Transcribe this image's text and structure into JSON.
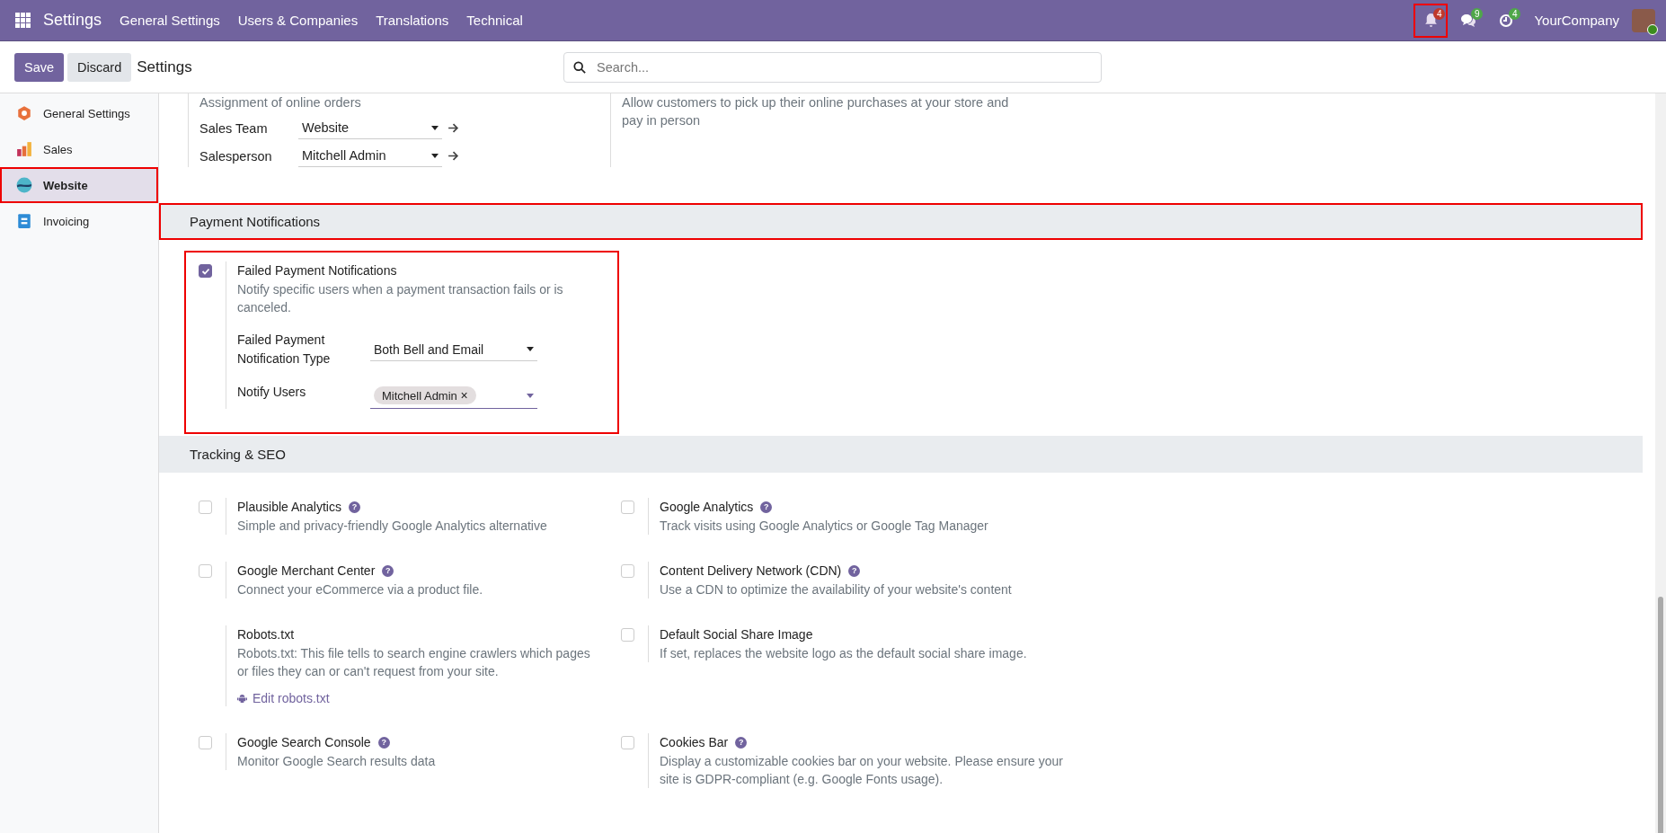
{
  "navbar": {
    "app_title": "Settings",
    "menu": [
      "General Settings",
      "Users & Companies",
      "Translations",
      "Technical"
    ],
    "systray": [
      {
        "kind": "bell",
        "badge": "4",
        "highlighted": true
      },
      {
        "kind": "chat",
        "badge": "9",
        "highlighted": false
      },
      {
        "kind": "clock",
        "badge": "4",
        "highlighted": false
      }
    ],
    "company": "YourCompany"
  },
  "control_panel": {
    "save": "Save",
    "discard": "Discard",
    "breadcrumb": "Settings",
    "search": {
      "placeholder": "Search..."
    }
  },
  "sidebar": {
    "items": [
      {
        "label": "General Settings",
        "kind": "general",
        "selected": false,
        "highlighted": false
      },
      {
        "label": "Sales",
        "kind": "sales",
        "selected": false,
        "highlighted": false
      },
      {
        "label": "Website",
        "kind": "website",
        "selected": true,
        "highlighted": true
      },
      {
        "label": "Invoicing",
        "kind": "invoicing",
        "selected": false,
        "highlighted": false
      }
    ]
  },
  "top_block": {
    "left_description": "Assignment of online orders",
    "fields": [
      {
        "label": "Sales Team",
        "value": "Website"
      },
      {
        "label": "Salesperson",
        "value": "Mitchell Admin"
      }
    ],
    "right_description": "Allow customers to pick up their online purchases at your store and pay in person"
  },
  "sections": [
    {
      "title": "Payment Notifications",
      "highlighted": true,
      "settings": [
        {
          "title": "Failed Payment Notifications",
          "kind": "checkbox",
          "checked": true,
          "highlighted": true,
          "description": "Notify specific users when a payment transaction fails or is canceled.",
          "fields": [
            {
              "kind": "select",
              "label": "Failed Payment Notification Type",
              "value": "Both Bell and Email"
            },
            {
              "kind": "tags",
              "label": "Notify Users",
              "tags": [
                {
                  "label": "Mitchell Admin",
                  "remove": "×"
                }
              ]
            }
          ]
        }
      ]
    },
    {
      "title": "Tracking & SEO",
      "highlighted": false,
      "settings": [
        {
          "title": "Plausible Analytics",
          "kind": "checkbox",
          "checked": false,
          "help": "?",
          "highlighted": false,
          "description": "Simple and privacy-friendly Google Analytics alternative"
        },
        {
          "title": "Google Analytics",
          "kind": "checkbox",
          "checked": false,
          "help": "?",
          "highlighted": false,
          "description": "Track visits using Google Analytics or Google Tag Manager"
        },
        {
          "title": "Google Merchant Center",
          "kind": "checkbox",
          "checked": false,
          "help": "?",
          "highlighted": false,
          "description": "Connect your eCommerce via a product file."
        },
        {
          "title": "Content Delivery Network (CDN)",
          "kind": "checkbox",
          "checked": false,
          "help": "?",
          "highlighted": false,
          "description": "Use a CDN to optimize the availability of your website's content"
        },
        {
          "title": "Robots.txt",
          "kind": "plain",
          "highlighted": false,
          "description": "Robots.txt: This file tells to search engine crawlers which pages or files they can or can't request from your site.",
          "link": "Edit robots.txt"
        },
        {
          "title": "Default Social Share Image",
          "kind": "checkbox",
          "checked": false,
          "highlighted": false,
          "description": "If set, replaces the website logo as the default social share image."
        },
        {
          "title": "Google Search Console",
          "kind": "checkbox",
          "checked": false,
          "help": "?",
          "highlighted": false,
          "description": "Monitor Google Search results data"
        },
        {
          "title": "Cookies Bar",
          "kind": "checkbox",
          "checked": false,
          "help": "?",
          "highlighted": false,
          "description": "Display a customizable cookies bar on your website. Please ensure your site is GDPR-compliant (e.g. Google Fonts usage)."
        }
      ]
    }
  ]
}
